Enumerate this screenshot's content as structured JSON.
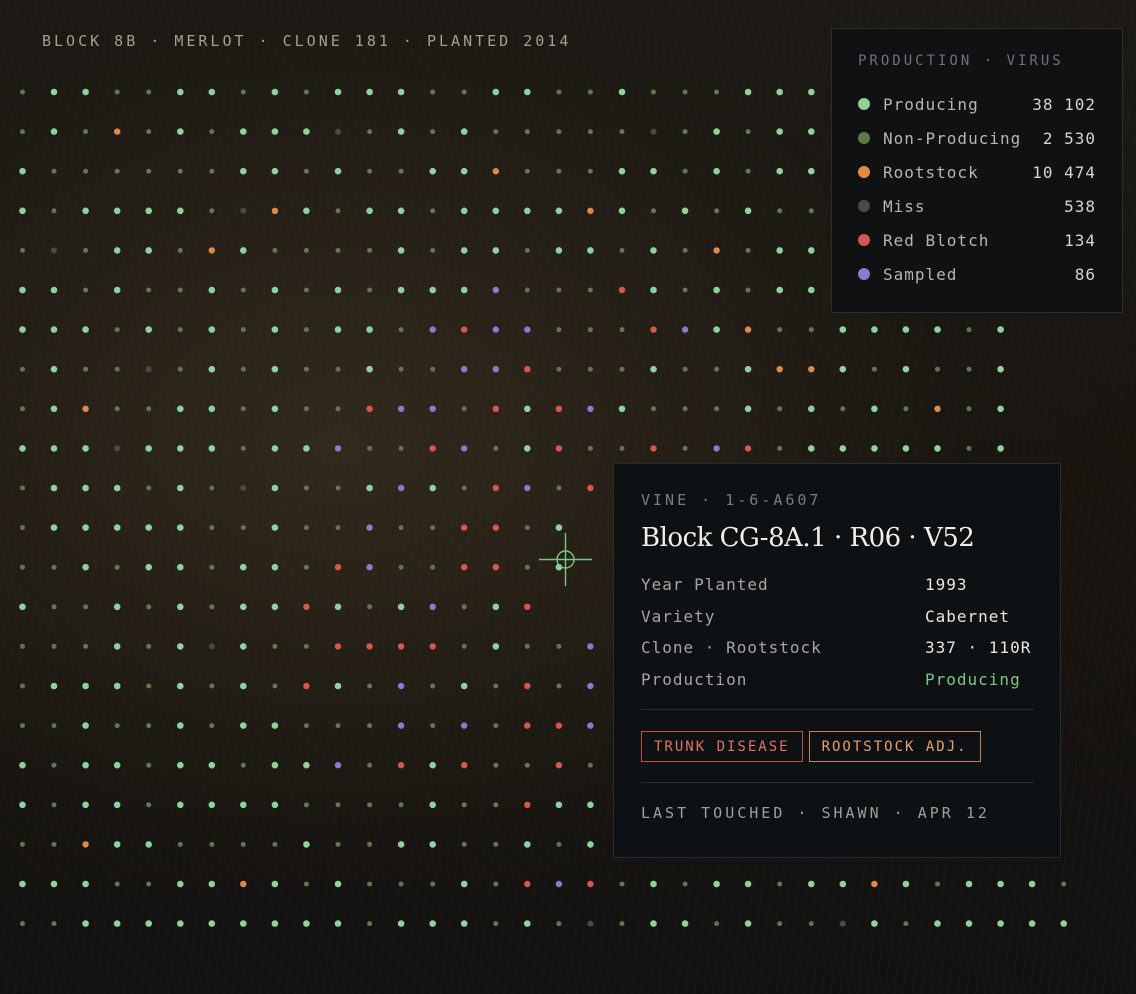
{
  "block_title": "BLOCK 8B · MERLOT · CLONE 181 · PLANTED 2014",
  "legend": {
    "title": "PRODUCTION · VIRUS",
    "items": [
      {
        "label": "Producing",
        "count": "38 102",
        "color": "#8fd29a"
      },
      {
        "label": "Non-Producing",
        "count": "2 530",
        "color": "#5f7a48"
      },
      {
        "label": "Rootstock",
        "count": "10 474",
        "color": "#e08a48"
      },
      {
        "label": "Miss",
        "count": "538",
        "color": "#4a4a48"
      },
      {
        "label": "Red Blotch",
        "count": "134",
        "color": "#d9574a"
      },
      {
        "label": "Sampled",
        "count": "86",
        "color": "#9077cf"
      }
    ]
  },
  "card": {
    "eyebrow": "VINE · 1-6-A607",
    "title": "Block CG-8A.1 · R06 · V52",
    "properties": [
      {
        "key": "Year Planted",
        "value": "1993",
        "status": "default"
      },
      {
        "key": "Variety",
        "value": "Cabernet",
        "status": "default"
      },
      {
        "key": "Clone · Rootstock",
        "value": "337 · 110R",
        "status": "default"
      },
      {
        "key": "Production",
        "value": "Producing",
        "status": "producing"
      }
    ],
    "tags": [
      {
        "label": "TRUNK DISEASE",
        "tone": "red"
      },
      {
        "label": "ROOTSTOCK ADJ.",
        "tone": "orange"
      }
    ],
    "footer": "LAST TOUCHED · SHAWN · APR 12"
  },
  "icons": {
    "crosshair": "crosshair-icon"
  },
  "colors": {
    "producing": "#8fd29a",
    "non_producing": "#5f7a48",
    "rootstock": "#e08a48",
    "miss": "#4a4a48",
    "red_blotch": "#d9574a",
    "sampled": "#9077cf",
    "accent_green": "#7fc487"
  },
  "vine_map": {
    "legend": "P = Producing, n = Non-Producing, R = Rootstock, M = Miss, B = Red Blotch, S = Sampled",
    "rows": [
      "nPPnnPPnPnPPPnnPPnnPnnnPPP",
      "nPnRnPnPPPMnPnPnnnnnMnPnPP",
      "PnnnnnnPPnPnnPPRnnnPPnPnPP",
      "PnPPPPnMRPnPPnPPPPRPnPnPnn",
      "nMnPPnRPnnnnPnPPnPPnPnRnPP",
      "PPnPnnPnPnPnPPPSnnnBPnPnPP",
      "PPPnPnPnPnPPnSBSSnnnBSPRnnPPPPnP",
      "nPnnMnPnPnnPnnSSBnnnPnnPRRPnPnnP",
      "nPRnnPPnPnnBSSnBPBSPnnnPnPnPnRnP",
      "PPPMPPPnPPSnnBSnPBnnBnSBnPPPPPnP",
      "nPPPnPnMPnnPSPnBSnB",
      "nPPPPPnnPnnSnnBBnP",
      "nnPnPPnPPnBSnnBBnP",
      "PnnPnPnPPBPnPSnPB",
      "nnnPnPMPnnBBBBnPnnS",
      "nPPPnPnPnBPnSnPnBnSP",
      "nnPnnPnPPnnnSnSnBBS",
      "PnPPnPPnPPSnBPBnnBnP",
      "PnPPnPPPPnnnnPnnBPPP",
      "nnRPPnnnnPnnPPnnPnPP",
      "PPPnnPPRPnPnnnPnBSBnPnPPnPPRPnPPPn",
      "nnPPPPPPPPPnPPPnPnMnPPnPnnMPnPPPPP"
    ]
  }
}
